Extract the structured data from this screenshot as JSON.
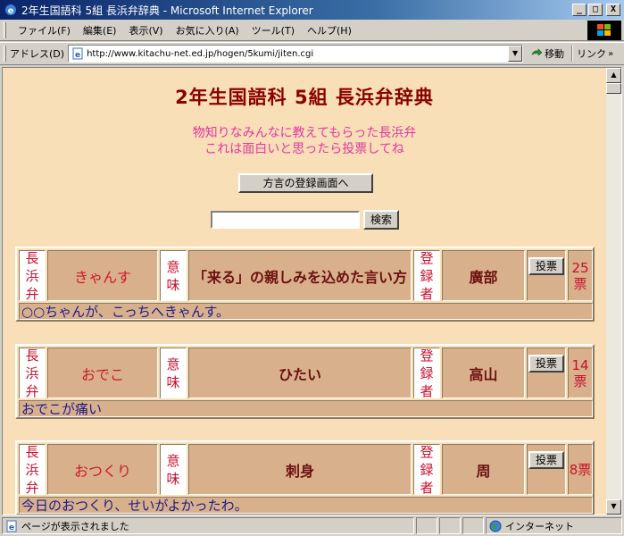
{
  "window": {
    "title": "2年生国語科  5組  長浜弁辞典 - Microsoft Internet Explorer",
    "minimize": "_",
    "maximize": "□",
    "close": "X"
  },
  "menu": {
    "items": [
      "ファイル(F)",
      "編集(E)",
      "表示(V)",
      "お気に入り(A)",
      "ツール(T)",
      "ヘルプ(H)"
    ]
  },
  "address": {
    "label": "アドレス(D)",
    "url": "http://www.kitachu-net.ed.jp/hogen/5kumi/jiten.cgi",
    "go": "移動",
    "links": "リンク",
    "links_arrow": "»"
  },
  "page": {
    "title": "2年生国語科  5組  長浜弁辞典",
    "subtitle_line1": "物知りなみんなに教えてもらった長浜弁",
    "subtitle_line2": "これは面白いと思ったら投票してね",
    "register_button": "方言の登録画面へ",
    "search_value": "",
    "search_button": "検索",
    "labels": {
      "dialect": "長浜弁",
      "meaning": "意味",
      "registrant": "登録者",
      "vote_button": "投票"
    },
    "entries": [
      {
        "word": "きゃんす",
        "meaning": "「来る」の親しみを込めた言い方",
        "registrant": "廣部",
        "votes": "25票",
        "example": "○○ちゃんが、こっちへきゃんす。"
      },
      {
        "word": "おでこ",
        "meaning": "ひたい",
        "registrant": "高山",
        "votes": "14票",
        "example": "おでこが痛い"
      },
      {
        "word": "おつくり",
        "meaning": "刺身",
        "registrant": "周",
        "votes": "8票",
        "example": "今日のおつくり、せいがよかったわ。"
      }
    ]
  },
  "status": {
    "text": "ページが表示されました",
    "zone": "インターネット"
  },
  "colors": {
    "page_bg": "#f9dfb7",
    "cell_bg": "#d9b08c",
    "title": "#8b0000",
    "subtitle": "#e0399f",
    "label_text": "#c8102e",
    "example_text": "#1a1a8c"
  }
}
